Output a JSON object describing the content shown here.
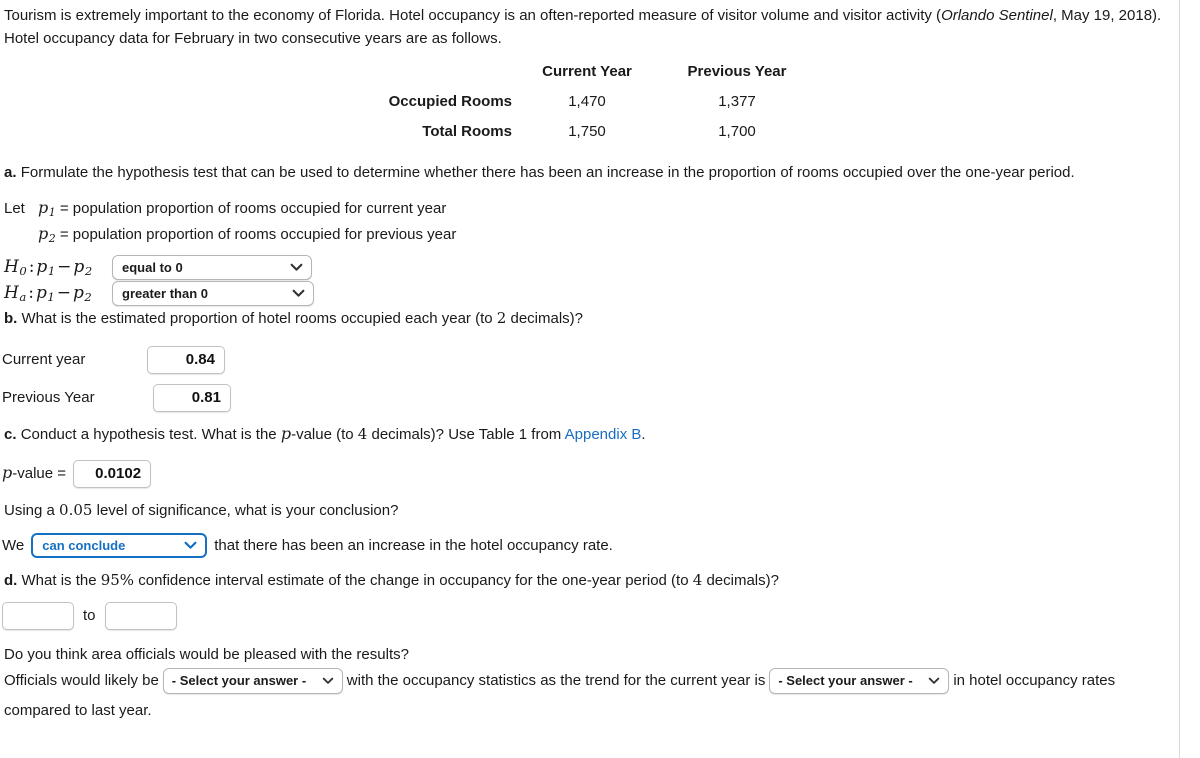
{
  "intro": {
    "text_before_italic": "Tourism is extremely important to the economy of Florida. Hotel occupancy is an often-reported measure of visitor volume and visitor activity (",
    "source_italic": "Orlando Sentinel",
    "text_after_italic": ", May 19, 2018). Hotel occupancy data for February in two consecutive years are as follows."
  },
  "table": {
    "headers": [
      "",
      "Current Year",
      "Previous Year"
    ],
    "rows": [
      {
        "label": "Occupied Rooms",
        "current": "1,470",
        "previous": "1,377"
      },
      {
        "label": "Total Rooms",
        "current": "1,750",
        "previous": "1,700"
      }
    ]
  },
  "part_a": {
    "marker": "a.",
    "prompt": "Formulate the hypothesis test that can be used to determine whether there has been an increase in the proportion of rooms occupied over the one-year period.",
    "let_label": "Let",
    "var1_symbol": "p",
    "var1_sub": "1",
    "var1_def": "= population proportion of rooms occupied for current year",
    "var2_symbol": "p",
    "var2_sub": "2",
    "var2_def": "= population proportion of rooms occupied for previous year",
    "h0_symbol": "H",
    "h0_sub": "0",
    "ha_symbol": "H",
    "ha_sub": "a",
    "h0_value": "equal to 0",
    "ha_value": "greater than 0"
  },
  "part_b": {
    "marker": "b.",
    "prompt_pre": "What is the estimated proportion of hotel rooms occupied each year (to ",
    "decimals": "2",
    "prompt_post": " decimals)?",
    "rows": [
      {
        "label": "Current year",
        "value": "0.84"
      },
      {
        "label": "Previous Year",
        "value": "0.81"
      }
    ]
  },
  "part_c": {
    "marker": "c.",
    "prompt_pre": "Conduct a hypothesis test. What is the ",
    "p_italic": "p",
    "prompt_mid": "-value (to ",
    "decimals": "4",
    "prompt_post": " decimals)? Use Table 1 from ",
    "link_text": "Appendix B",
    "prompt_end": ".",
    "pvalue_label_p": "p",
    "pvalue_label_rest": "-value =",
    "pvalue": "0.0102",
    "significance_pre": "Using a ",
    "significance_level": "0.05",
    "significance_post": " level of significance, what is your conclusion?",
    "we_label": "We",
    "conclusion_value": "can conclude",
    "conclusion_tail": "that there has been an increase in the hotel occupancy rate."
  },
  "part_d": {
    "marker": "d.",
    "prompt_pre": "What is the ",
    "confidence": "95%",
    "prompt_mid": " confidence interval estimate of the change in occupancy for the one-year period (to ",
    "decimals": "4",
    "prompt_post": " decimals)?",
    "lower_value": "",
    "upper_value": "",
    "between_label": "to",
    "officials_question": "Do you think area officials would be pleased with the results?",
    "officials_pre": "Officials would likely be",
    "select_placeholder_1": "- Select your answer -",
    "officials_mid": "with the occupancy statistics as the trend for the current year is",
    "select_placeholder_2": "- Select your answer -",
    "officials_post": "in hotel occupancy rates compared to last year."
  },
  "colors": {
    "link": "#1a6dc4",
    "focus_border": "#1570c4",
    "text": "#1a1a1a"
  }
}
